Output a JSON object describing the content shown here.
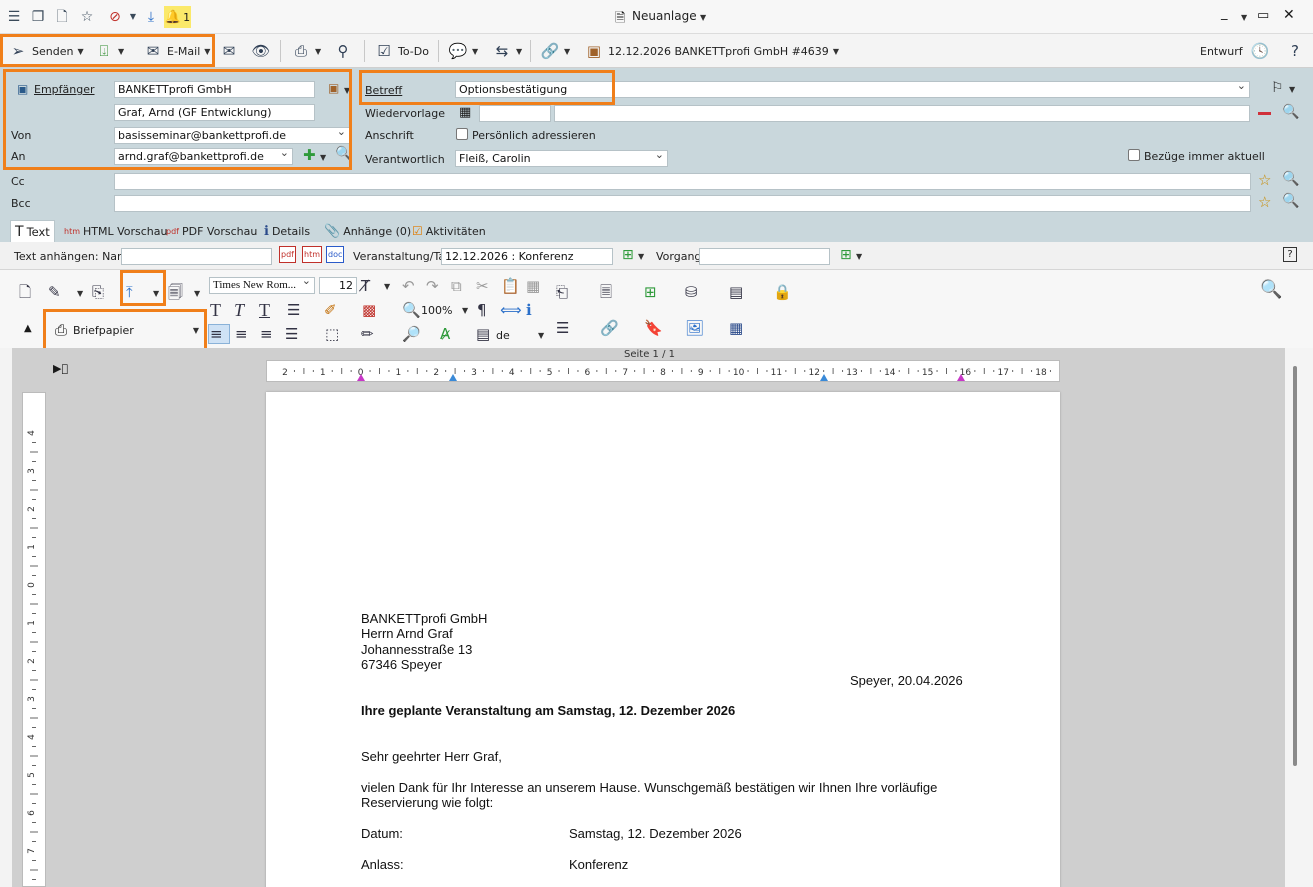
{
  "window": {
    "title": "Neuanlage",
    "notification_count": "1"
  },
  "toolbar": {
    "send_label": "Senden",
    "email_label": "E-Mail",
    "todo_label": "To-Do",
    "record_label": "12.12.2026 BANKETTprofi GmbH #4639",
    "status_label": "Entwurf"
  },
  "header": {
    "recipient_label": "Empfänger",
    "recipient_company": "BANKETTprofi GmbH",
    "recipient_person": "Graf, Arnd (GF Entwicklung)",
    "from_label": "Von",
    "from_value": "basisseminar@bankettprofi.de",
    "to_label": "An",
    "to_value": "arnd.graf@bankettprofi.de",
    "cc_label": "Cc",
    "bcc_label": "Bcc",
    "subject_label": "Betreff",
    "subject_value": "Optionsbestätigung",
    "followup_label": "Wiedervorlage",
    "address_label": "Anschrift",
    "personal_label": "Persönlich adressieren",
    "responsible_label": "Verantwortlich",
    "responsible_value": "Fleiß, Carolin",
    "refs_label": "Bezüge immer aktuell"
  },
  "tabs": [
    {
      "label": "Text"
    },
    {
      "label": "HTML Vorschau"
    },
    {
      "label": "PDF Vorschau"
    },
    {
      "label": "Details"
    },
    {
      "label": "Anhänge (0)"
    },
    {
      "label": "Aktivitäten"
    }
  ],
  "attach": {
    "name_label": "Text anhängen: Name",
    "event_label": "Veranstaltung/Tag",
    "event_value": "12.12.2026 : Konferenz",
    "process_label": "Vorgang"
  },
  "format": {
    "font_name": "Times New Rom...",
    "font_size": "12",
    "zoom": "100%",
    "language": "de",
    "letterhead": "Briefpapier"
  },
  "editor": {
    "page_indicator": "Seite 1 / 1",
    "ruler_labels": [
      "2",
      "1",
      "0",
      "1",
      "2",
      "3",
      "4",
      "5",
      "6",
      "7",
      "8",
      "9",
      "10",
      "11",
      "12",
      "13",
      "14",
      "15",
      "16",
      "17",
      "18"
    ],
    "vruler_labels": [
      "4",
      "3",
      "2",
      "1",
      "0",
      "1",
      "2",
      "3",
      "4",
      "5",
      "6",
      "7"
    ]
  },
  "letter": {
    "addr1": "BANKETTprofi GmbH",
    "addr2": "Herrn Arnd Graf",
    "addr3": "Johannesstraße 13",
    "addr4": "67346 Speyer",
    "date": "Speyer, 20.04.2026",
    "subject": "Ihre geplante Veranstaltung am Samstag, 12. Dezember 2026",
    "salutation": "Sehr geehrter Herr Graf,",
    "body1": "vielen Dank für Ihr Interesse an unserem Hause. Wunschgemäß bestätigen wir Ihnen Ihre vorläufige",
    "body2": "Reservierung wie folgt:",
    "date_label": "Datum:",
    "date_value": "Samstag, 12. Dezember 2026",
    "occasion_label": "Anlass:",
    "occasion_value": "Konferenz"
  }
}
